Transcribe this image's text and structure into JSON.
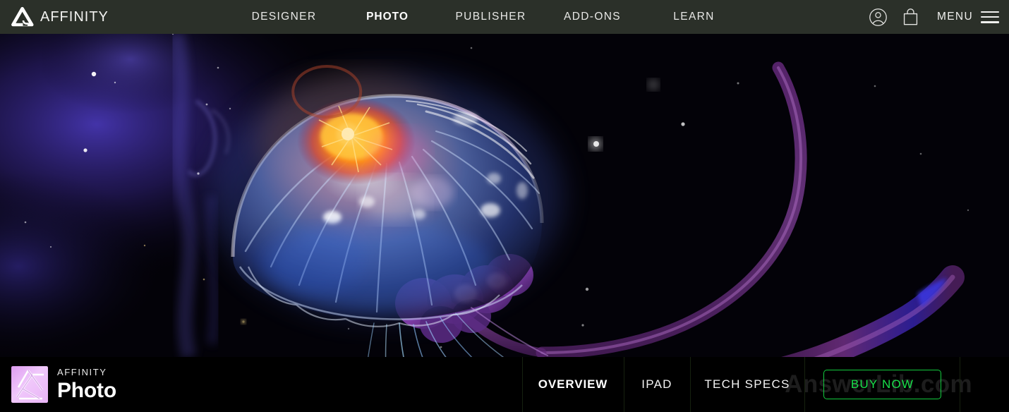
{
  "header": {
    "logo_icon": "affinity-triangle-logo-icon",
    "brand": "AFFINITY",
    "nav": [
      {
        "label": "DESIGNER",
        "active": false
      },
      {
        "label": "PHOTO",
        "active": true
      },
      {
        "label": "PUBLISHER",
        "active": false
      },
      {
        "label": "ADD-ONS",
        "active": false
      },
      {
        "label": "LEARN",
        "active": false
      }
    ],
    "account_icon": "account-person-circle-icon",
    "bag_icon": "shopping-bag-icon",
    "menu_label": "MENU",
    "menu_icon": "hamburger-menu-icon",
    "background_color": "#2b3029",
    "text_color": "#e8e8e6"
  },
  "hero": {
    "alt": "Bioluminescent glowing jellyfish with orange-yellow core and blue-purple translucent dome floating in a dark purple nebula starfield",
    "background_color": "#020104",
    "nebula_color": "#3b2f8f",
    "jellyfish_core_color": "#ff9a16",
    "jellyfish_dome_color": "#5a8ad8",
    "tentacle_color": "#7d3a8e"
  },
  "bottom_bar": {
    "background_color": "#000000",
    "product_icon": "affinity-photo-app-icon",
    "product_brand": "AFFINITY",
    "product_title": "Photo",
    "tabs": [
      {
        "label": "OVERVIEW",
        "active": true
      },
      {
        "label": "IPAD",
        "active": false
      },
      {
        "label": "TECH SPECS",
        "active": false
      }
    ],
    "buy_label": "BUY NOW",
    "buy_color": "#19e04b",
    "watermark": "AnswerLib.com"
  }
}
